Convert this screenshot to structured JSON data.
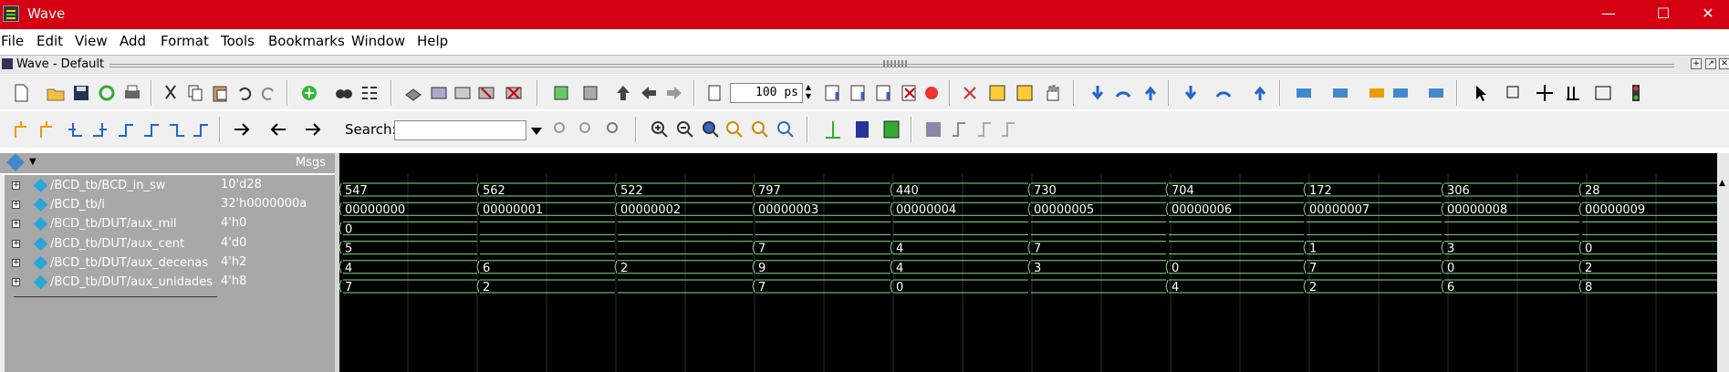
{
  "window": {
    "title": "Wave",
    "min": "—",
    "max": "☐",
    "close": "✕"
  },
  "menu": [
    "File",
    "Edit",
    "View",
    "Add",
    "Format",
    "Tools",
    "Bookmarks",
    "Window",
    "Help"
  ],
  "pane": {
    "title": "Wave - Default"
  },
  "toolbar": {
    "time_value": "100 ps",
    "search_label": "Search:",
    "search_value": ""
  },
  "header": {
    "msgs_label": "Msgs"
  },
  "signals": [
    {
      "name": "/BCD_tb/BCD_in_sw",
      "value": "10'd28",
      "segments": [
        "547",
        "562",
        "522",
        "797",
        "440",
        "730",
        "704",
        "172",
        "306",
        "28"
      ]
    },
    {
      "name": "/BCD_tb/i",
      "value": "32'h0000000a",
      "segments": [
        "00000000",
        "00000001",
        "00000002",
        "00000003",
        "00000004",
        "00000005",
        "00000006",
        "00000007",
        "00000008",
        "00000009"
      ]
    },
    {
      "name": "/BCD_tb/DUT/aux_mil",
      "value": "4'h0",
      "segments": [
        "0",
        "",
        "",
        "",
        "",
        "",
        "",
        "",
        "",
        ""
      ]
    },
    {
      "name": "/BCD_tb/DUT/aux_cent",
      "value": "4'd0",
      "segments": [
        "5",
        "",
        "",
        "7",
        "4",
        "7",
        "",
        "1",
        "3",
        "0"
      ]
    },
    {
      "name": "/BCD_tb/DUT/aux_decenas",
      "value": "4'h2",
      "segments": [
        "4",
        "6",
        "2",
        "9",
        "4",
        "3",
        "0",
        "7",
        "0",
        "2"
      ]
    },
    {
      "name": "/BCD_tb/DUT/aux_unidades",
      "value": "4'h8",
      "segments": [
        "7",
        "2",
        "",
        "7",
        "0",
        "",
        "4",
        "2",
        "6",
        "8"
      ]
    }
  ],
  "colors": {
    "titlebar": "#d50012",
    "wave": "#7fe07f",
    "background": "#000000",
    "panel": "#a8a8a8"
  }
}
